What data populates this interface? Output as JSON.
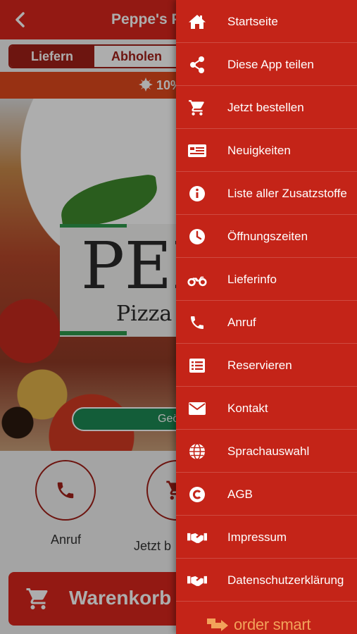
{
  "header": {
    "title": "Peppe's Piz"
  },
  "order_mode": {
    "delivery_label": "Liefern",
    "pickup_label": "Abholen"
  },
  "promo": {
    "text": "10%"
  },
  "hero": {
    "logo_big": "PEPP",
    "logo_small": "Pizza",
    "pill_text": "Geö"
  },
  "quick_actions": [
    {
      "label": "Anruf",
      "icon": "phone-icon"
    },
    {
      "label": "Jetzt b",
      "icon": "cart-icon"
    }
  ],
  "cart_button": {
    "label": "Warenkorb"
  },
  "drawer": {
    "items": [
      {
        "label": "Startseite",
        "icon": "home-icon"
      },
      {
        "label": "Diese App teilen",
        "icon": "share-icon"
      },
      {
        "label": "Jetzt bestellen",
        "icon": "cart-icon"
      },
      {
        "label": "Neuigkeiten",
        "icon": "news-icon"
      },
      {
        "label": "Liste aller Zusatzstoffe",
        "icon": "info-icon"
      },
      {
        "label": "Öffnungszeiten",
        "icon": "clock-icon"
      },
      {
        "label": "Lieferinfo",
        "icon": "motorbike-icon"
      },
      {
        "label": "Anruf",
        "icon": "phone-icon"
      },
      {
        "label": "Reservieren",
        "icon": "list-icon"
      },
      {
        "label": "Kontakt",
        "icon": "envelope-icon"
      },
      {
        "label": "Sprachauswahl",
        "icon": "globe-icon"
      },
      {
        "label": "AGB",
        "icon": "copyright-icon"
      },
      {
        "label": "Impressum",
        "icon": "handshake-icon"
      },
      {
        "label": "Datenschutzerklärung",
        "icon": "handshake-icon"
      }
    ],
    "footer_brand": "order smart"
  },
  "colors": {
    "brand_red": "#d9261c",
    "drawer_red": "#c42418",
    "dark_red": "#a11f18",
    "promo_orange": "#e0491c",
    "green": "#1c8a55",
    "footer_orange": "#f2a25a"
  }
}
